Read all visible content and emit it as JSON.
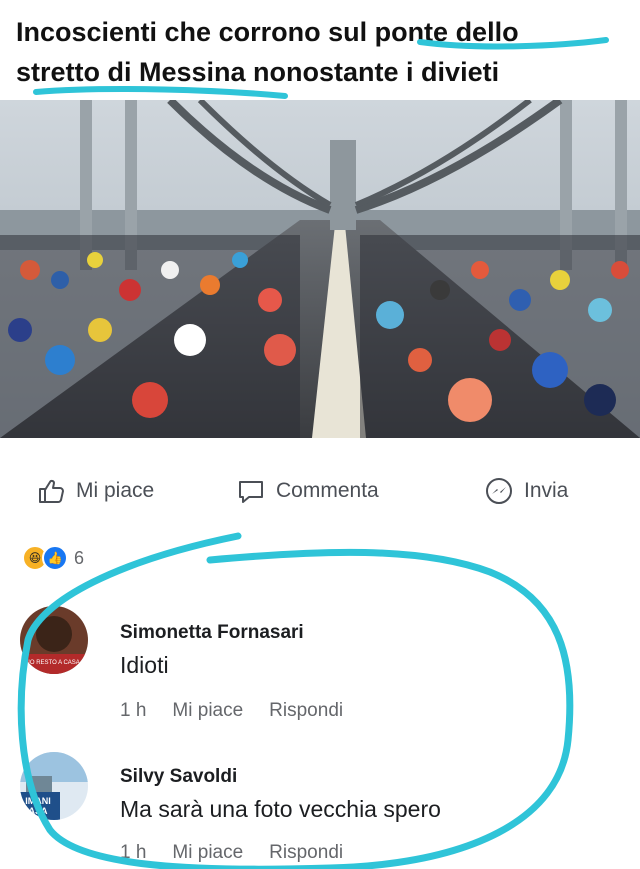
{
  "post": {
    "title_line1": "Incoscienti che corrono sul ponte dello",
    "title_line2": "stretto di Messina nonostante i divieti"
  },
  "actions": {
    "like": "Mi piace",
    "comment": "Commenta",
    "share": "Invia"
  },
  "reactions": {
    "icons": [
      "haha-icon",
      "like-icon"
    ],
    "count": "6"
  },
  "comments": [
    {
      "author": "Simonetta Fornasari",
      "text": "Idioti",
      "time": "1 h",
      "like": "Mi piace",
      "reply": "Rispondi"
    },
    {
      "author": "Silvy Savoldi",
      "text": "Ma sarà una foto vecchia spero",
      "time": "1 h",
      "like": "Mi piace",
      "reply": "Rispondi"
    }
  ],
  "avatar_texts": {
    "first": "IO RESTO A CASA",
    "second_line1": "IMANI",
    "second_line2": "ASA"
  },
  "colors": {
    "highlight": "#2fc4d8",
    "icon_gray": "#4b4f56",
    "meta_gray": "#65676b",
    "like_blue": "#1877f2"
  }
}
